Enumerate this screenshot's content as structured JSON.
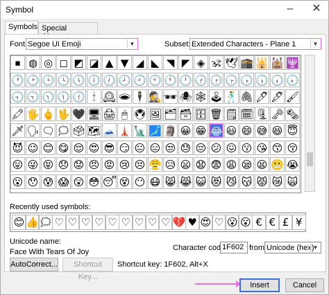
{
  "window": {
    "title": "Symbol",
    "minimize": "–",
    "close": "✕"
  },
  "tabs": [
    {
      "label": "Symbols",
      "active": true
    },
    {
      "label": "Special Characters",
      "active": false
    }
  ],
  "font": {
    "label": "Font:",
    "value": "Segoe UI Emoji"
  },
  "subset": {
    "label": "Subset:",
    "value": "Extended Characters - Plane 1"
  },
  "grid_rows": [
    [
      "⏹",
      "◍",
      "◎",
      "◻",
      "◩",
      "◪",
      "▲",
      "▼",
      "◢",
      "◣",
      "◥",
      "◤",
      "◈",
      "🕉",
      "🕊",
      "🕋",
      "🕌",
      "🕍",
      "🕎"
    ],
    [
      "🕐",
      "🕑",
      "🕒",
      "🕓",
      "🕔",
      "🕕",
      "🕖",
      "🕗",
      "🕘",
      "🕙",
      "🕚",
      "🕛",
      "🕜",
      "🕝",
      "🕞",
      "🕟",
      "🕠",
      "🕡",
      "🕢"
    ],
    [
      "🕣",
      "🕤",
      "🕥",
      "🕦",
      "🕧",
      "🕯",
      "🕰",
      "🕳",
      "🕴",
      "🕵",
      "🕶",
      "🕷",
      "🕸",
      "🕹",
      "🕺",
      "🖇",
      "🖊",
      "🖋",
      "🖌"
    ],
    [
      "🖍",
      "🖐",
      "🖕",
      "🖖",
      "🖤",
      "🖥",
      "🖨",
      "🖱",
      "🖲",
      "🖼",
      "🗂",
      "🗃",
      "🗄",
      "🗑",
      "🗒",
      "🗓",
      "🗜",
      "🗝",
      "🗞"
    ],
    [
      "🗡",
      "🗣",
      "🗨",
      "🗯",
      "🗳",
      "🗺",
      "🗻",
      "🗼",
      "🗽",
      "🗾",
      "🗿",
      "😀",
      "😁",
      "😂",
      "😃",
      "😄",
      "😅",
      "😆",
      "😇"
    ],
    [
      "😈",
      "😉",
      "😊",
      "😋",
      "😌",
      "😍",
      "😎",
      "😏",
      "😐",
      "😑",
      "😒",
      "😓",
      "😔",
      "😕",
      "😖",
      "😗",
      "😘",
      "😙",
      "😚"
    ],
    [
      "😛",
      "😜",
      "😝",
      "😞",
      "😟",
      "😠",
      "😡",
      "😢",
      "😣",
      "😤",
      "😥",
      "😦",
      "😧",
      "😨",
      "😩",
      "😪",
      "😫",
      "😬",
      "😭"
    ],
    [
      "😮",
      "😯",
      "😰",
      "😱",
      "😲",
      "😳",
      "😴",
      "😵",
      "😶",
      "😷",
      "😸",
      "😹",
      "😺",
      "😻",
      "😼",
      "😽",
      "😾",
      "😿",
      "🙀"
    ]
  ],
  "recent": {
    "label": "Recently used symbols:",
    "symbols": [
      "😊",
      "👍",
      "🗯",
      "♡",
      "♡",
      "♡",
      "♡",
      "♡",
      "♡",
      "♡",
      "♡",
      "♡",
      "💔",
      "♥",
      "😍",
      "♡",
      "😮",
      "😮",
      "€",
      "€",
      "£",
      "¥"
    ]
  },
  "unicode_name": {
    "label": "Unicode name:",
    "value": "Face With Tears Of Joy"
  },
  "character_code": {
    "label": "Character code:",
    "value": "1F602"
  },
  "from": {
    "label": "from:",
    "value": "Unicode (hex)"
  },
  "shortcut_key_text": "Shortcut key: 1F602, Alt+X",
  "buttons": {
    "autocorrect": "AutoCorrect...",
    "shortcut_key": "Shortcut Key...",
    "insert": "Insert",
    "cancel": "Cancel"
  },
  "colors": {
    "selection": "#3f6ed8",
    "highlight": "#e46fe6"
  }
}
